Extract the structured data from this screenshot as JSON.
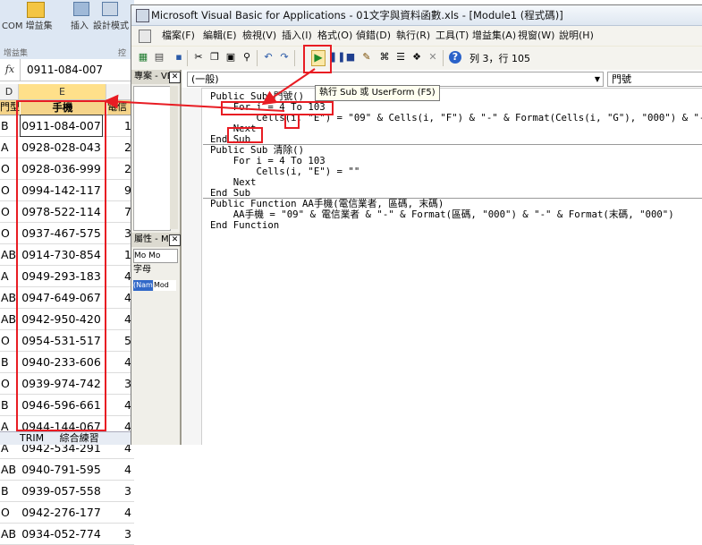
{
  "excel": {
    "ribbon": {
      "com_addins_label": "COM 增益集",
      "insert_label": "插入",
      "design_mode_label": "設計模式",
      "addins_group_label": "增益集",
      "controls_group_label": "控"
    },
    "name_box_value": "",
    "formula_bar_value": "0911-084-007",
    "columns": [
      "D",
      "E"
    ],
    "header_row": {
      "type": "門型",
      "phone": "手機",
      "carrier": "電信"
    },
    "rows": [
      {
        "type": "B",
        "phone": "0911-084-007",
        "c": "1"
      },
      {
        "type": "A",
        "phone": "0928-028-043",
        "c": "2"
      },
      {
        "type": "O",
        "phone": "0928-036-999",
        "c": "2"
      },
      {
        "type": "O",
        "phone": "0994-142-117",
        "c": "9"
      },
      {
        "type": "O",
        "phone": "0978-522-114",
        "c": "7"
      },
      {
        "type": "O",
        "phone": "0937-467-575",
        "c": "3"
      },
      {
        "type": "AB",
        "phone": "0914-730-854",
        "c": "1"
      },
      {
        "type": "A",
        "phone": "0949-293-183",
        "c": "4"
      },
      {
        "type": "AB",
        "phone": "0947-649-067",
        "c": "4"
      },
      {
        "type": "AB",
        "phone": "0942-950-420",
        "c": "4"
      },
      {
        "type": "O",
        "phone": "0954-531-517",
        "c": "5"
      },
      {
        "type": "B",
        "phone": "0940-233-606",
        "c": "4"
      },
      {
        "type": "O",
        "phone": "0939-974-742",
        "c": "3"
      },
      {
        "type": "B",
        "phone": "0946-596-661",
        "c": "4"
      },
      {
        "type": "A",
        "phone": "0944-144-067",
        "c": "4"
      },
      {
        "type": "A",
        "phone": "0942-534-291",
        "c": "4"
      },
      {
        "type": "AB",
        "phone": "0940-791-595",
        "c": "4"
      },
      {
        "type": "B",
        "phone": "0939-057-558",
        "c": "3"
      },
      {
        "type": "O",
        "phone": "0942-276-177",
        "c": "4"
      },
      {
        "type": "AB",
        "phone": "0934-052-774",
        "c": "3"
      }
    ],
    "sheet_tabs": [
      "TRIM",
      "綜合練習"
    ]
  },
  "vbe": {
    "title": "Microsoft Visual Basic for Applications - 01文字與資料函數.xls - [Module1 (程式碼)]",
    "menu": [
      "檔案(F)",
      "編輯(E)",
      "檢視(V)",
      "插入(I)",
      "格式(O)",
      "偵錯(D)",
      "執行(R)",
      "工具(T)",
      "增益集(A)",
      "視窗(W)",
      "說明(H)"
    ],
    "cursor_position": "列 3，行 105",
    "run_tooltip": "執行 Sub 或 UserForm (F5)",
    "project_pane_title": "專案 - VB",
    "properties_pane_title": "屬性 - Mo",
    "properties_object": "Mo Mo",
    "properties_tab": "字母",
    "properties_name_cell": "(Nam",
    "properties_name_value": "Mod",
    "object_combo": "(一般)",
    "procedure_combo": "門號",
    "code_lines": [
      "Public Sub 門號()",
      "    For i = 4 To 103",
      "        Cells(i, \"E\") = \"09\" & Cells(i, \"F\") & \"-\" & Format(Cells(i, \"G\"), \"000\") & \"-\"",
      "    Next",
      "End Sub",
      "Public Sub 清除()",
      "    For i = 4 To 103",
      "        Cells(i, \"E\") = \"\"",
      "    Next",
      "End Sub",
      "Public Function AA手機(電信業者, 區碼, 末碼)",
      "    AA手機 = \"09\" & 電信業者 & \"-\" & Format(區碼, \"000\") & \"-\" & Format(末碼, \"000\")",
      "End Function"
    ]
  },
  "annotation_color": "#e81c23"
}
